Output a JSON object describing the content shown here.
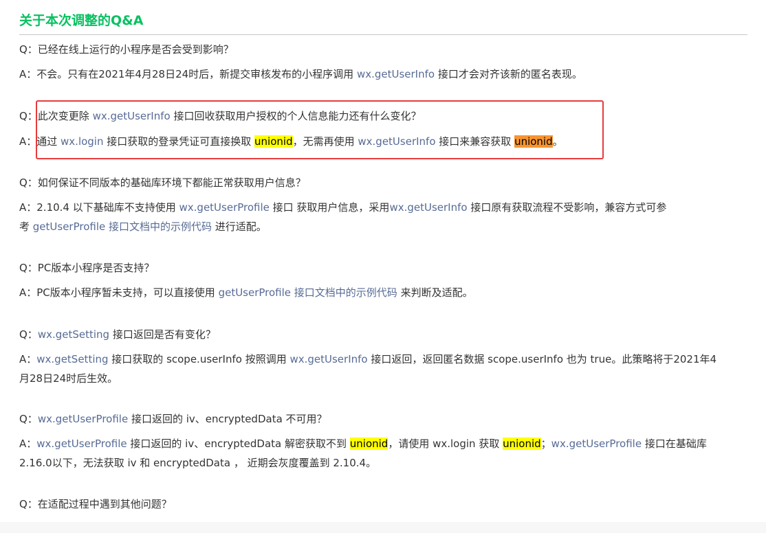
{
  "title": "关于本次调整的Q&A",
  "qa": {
    "q1": "Q：已经在线上运行的小程序是否会受到影响？",
    "a1": {
      "p1": "A：不会。只有在2021年4月28日24时后，新提交审核发布的小程序调用 ",
      "link1": "wx.getUserInfo",
      "p2": " 接口才会对齐该新的匿名表现。"
    },
    "q2": {
      "p1": "Q：此次变更除 ",
      "link1": "wx.getUserInfo",
      "p2": " 接口回收获取用户授权的个人信息能力还有什么变化？"
    },
    "a2": {
      "p1": "A：通过 ",
      "link1": "wx.login",
      "p2": " 接口获取的登录凭证可直接换取 ",
      "hl1": "unionid",
      "p3": "，无需再使用 ",
      "link2": "wx.getUserInfo",
      "p4": " 接口来兼容获取 ",
      "hl2": "unionid",
      "p5": "。"
    },
    "q3": "Q：如何保证不同版本的基础库环境下都能正常获取用户信息？",
    "a3": {
      "p1": "A：2.10.4 以下基础库不支持使用 ",
      "link1": "wx.getUserProfile",
      "p2": " 接口 获取用户信息，采用",
      "link2": "wx.getUserInfo",
      "p3": " 接口原有获取流程不受影响，兼容方式可参",
      "p4": "考 ",
      "link3": "getUserProfile 接口文档中的示例代码",
      "p5": " 进行适配。"
    },
    "q4": "Q：PC版本小程序是否支持？",
    "a4": {
      "p1": "A：PC版本小程序暂未支持，可以直接使用 ",
      "link1": "getUserProfile 接口文档中的示例代码",
      "p2": " 来判断及适配。"
    },
    "q5": {
      "p1": "Q：",
      "link1": "wx.getSetting",
      "p2": " 接口返回是否有变化？"
    },
    "a5": {
      "p1": "A：",
      "link1": "wx.getSetting",
      "p2": " 接口获取的 scope.userInfo 按照调用 ",
      "link2": "wx.getUserInfo",
      "p3": " 接口返回，返回匿名数据 scope.userInfo 也为 true。此策略将于2021年4",
      "p4": "月28日24时后生效。"
    },
    "q6": {
      "p1": "Q：",
      "link1": "wx.getUserProfile",
      "p2": " 接口返回的 iv、encryptedData 不可用？"
    },
    "a6": {
      "p1": "A：",
      "link1": "wx.getUserProfile",
      "p2": " 接口返回的 iv、encryptedData 解密获取不到 ",
      "hl1": "unionid",
      "p3": "，请使用 wx.login 获取 ",
      "hl2": "unionid",
      "p4": "；",
      "link2": "wx.getUserProfile",
      "p5": " 接口在基础库",
      "p6": "2.16.0以下，无法获取 iv 和 encryptedData ， 近期会灰度覆盖到 2.10.4。"
    },
    "q7": "Q：在适配过程中遇到其他问题？"
  },
  "colors": {
    "title": "#07c160",
    "link": "#576b95",
    "highlight_yellow": "#ffff00",
    "highlight_orange": "#f79430",
    "annotation_box": "#e63b3b"
  }
}
